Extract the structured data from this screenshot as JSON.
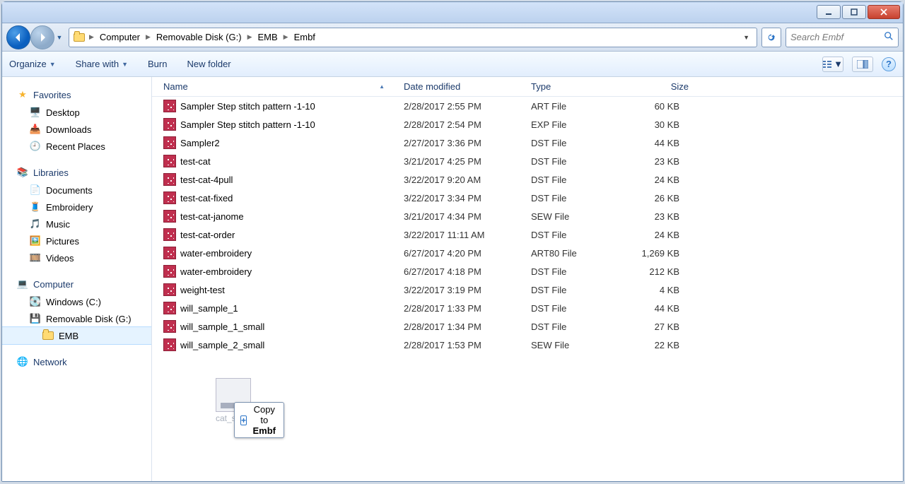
{
  "window_controls": {
    "min": "minimize",
    "max": "maximize",
    "close": "close"
  },
  "breadcrumb": [
    "Computer",
    "Removable Disk (G:)",
    "EMB",
    "Embf"
  ],
  "search": {
    "placeholder": "Search Embf"
  },
  "toolbar": {
    "organize": "Organize",
    "share": "Share with",
    "burn": "Burn",
    "newfolder": "New folder"
  },
  "sidebar": {
    "favorites": {
      "label": "Favorites",
      "items": [
        "Desktop",
        "Downloads",
        "Recent Places"
      ]
    },
    "libraries": {
      "label": "Libraries",
      "items": [
        "Documents",
        "Embroidery",
        "Music",
        "Pictures",
        "Videos"
      ]
    },
    "computer": {
      "label": "Computer",
      "items": [
        "Windows (C:)",
        "Removable Disk (G:)"
      ],
      "sub": "EMB"
    },
    "network": {
      "label": "Network"
    }
  },
  "columns": {
    "name": "Name",
    "date": "Date modified",
    "type": "Type",
    "size": "Size"
  },
  "files": [
    {
      "name": "Sampler Step stitch pattern -1-10",
      "date": "2/28/2017 2:55 PM",
      "type": "ART File",
      "size": "60 KB"
    },
    {
      "name": "Sampler Step stitch pattern -1-10",
      "date": "2/28/2017 2:54 PM",
      "type": "EXP File",
      "size": "30 KB"
    },
    {
      "name": "Sampler2",
      "date": "2/27/2017 3:36 PM",
      "type": "DST File",
      "size": "44 KB"
    },
    {
      "name": "test-cat",
      "date": "3/21/2017 4:25 PM",
      "type": "DST File",
      "size": "23 KB"
    },
    {
      "name": "test-cat-4pull",
      "date": "3/22/2017 9:20 AM",
      "type": "DST File",
      "size": "24 KB"
    },
    {
      "name": "test-cat-fixed",
      "date": "3/22/2017 3:34 PM",
      "type": "DST File",
      "size": "26 KB"
    },
    {
      "name": "test-cat-janome",
      "date": "3/21/2017 4:34 PM",
      "type": "SEW File",
      "size": "23 KB"
    },
    {
      "name": "test-cat-order",
      "date": "3/22/2017 11:11 AM",
      "type": "DST File",
      "size": "24 KB"
    },
    {
      "name": "water-embroidery",
      "date": "6/27/2017 4:20 PM",
      "type": "ART80 File",
      "size": "1,269 KB"
    },
    {
      "name": "water-embroidery",
      "date": "6/27/2017 4:18 PM",
      "type": "DST File",
      "size": "212 KB"
    },
    {
      "name": "weight-test",
      "date": "3/22/2017 3:19 PM",
      "type": "DST File",
      "size": "4 KB"
    },
    {
      "name": "will_sample_1",
      "date": "2/28/2017 1:33 PM",
      "type": "DST File",
      "size": "44 KB"
    },
    {
      "name": "will_sample_1_small",
      "date": "2/28/2017 1:34 PM",
      "type": "DST File",
      "size": "27 KB"
    },
    {
      "name": "will_sample_2_small",
      "date": "2/28/2017 1:53 PM",
      "type": "SEW File",
      "size": "22 KB"
    }
  ],
  "drag": {
    "filename": "cat_stitch",
    "tip_prefix": "Copy to ",
    "tip_target": "Embf"
  }
}
